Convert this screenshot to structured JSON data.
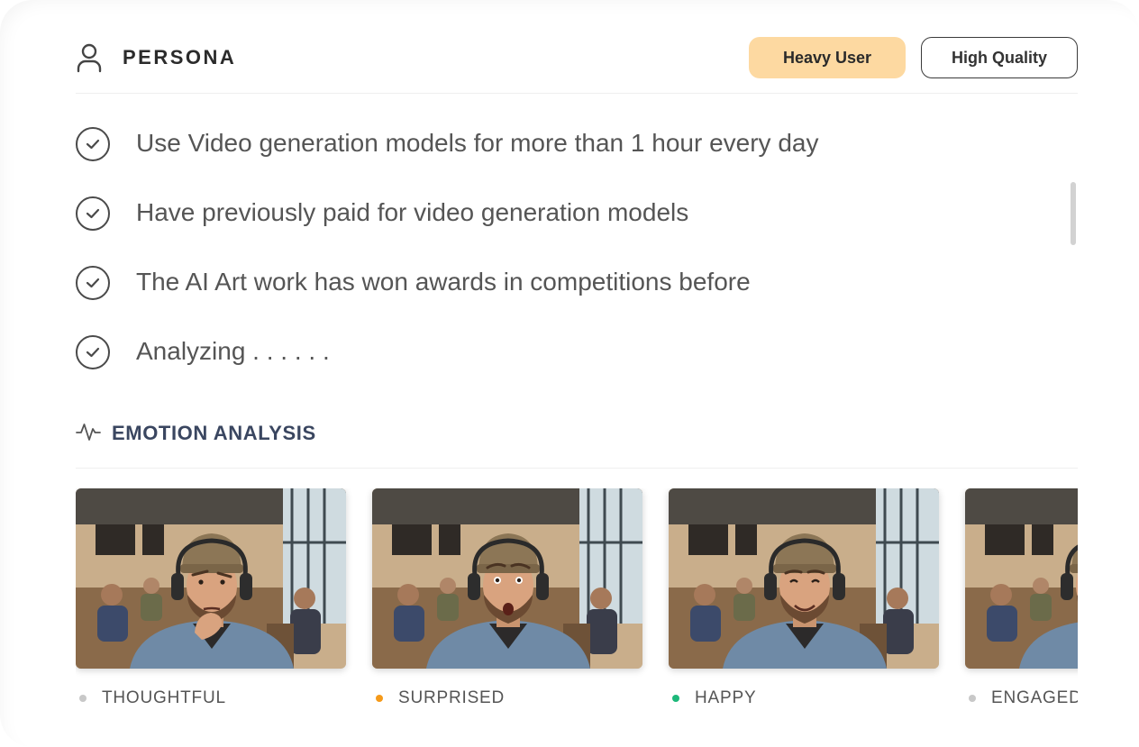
{
  "persona": {
    "title": "PERSONA",
    "icon": "user-icon",
    "badges": [
      {
        "label": "Heavy User",
        "color": "#fdd9a1"
      },
      {
        "label": "High Quality",
        "color": "#ffffff"
      }
    ],
    "items": [
      {
        "text": "Use Video generation models for more than 1 hour every day"
      },
      {
        "text": "Have previously paid for video generation models"
      },
      {
        "text": "The AI Art work has won awards in competitions before"
      },
      {
        "text": "Analyzing . . . . . ."
      }
    ]
  },
  "emotion": {
    "title": "EMOTION ANALYSIS",
    "icon": "activity-icon",
    "cards": [
      {
        "label": "THOUGHTFUL",
        "dot_color": "#c8c8c8",
        "expression": "thoughtful"
      },
      {
        "label": "SURPRISED",
        "dot_color": "#f59a1a",
        "expression": "surprised"
      },
      {
        "label": "HAPPY",
        "dot_color": "#1db87a",
        "expression": "happy"
      },
      {
        "label": "ENGAGED",
        "dot_color": "#c8c8c8",
        "expression": "engaged"
      }
    ]
  }
}
